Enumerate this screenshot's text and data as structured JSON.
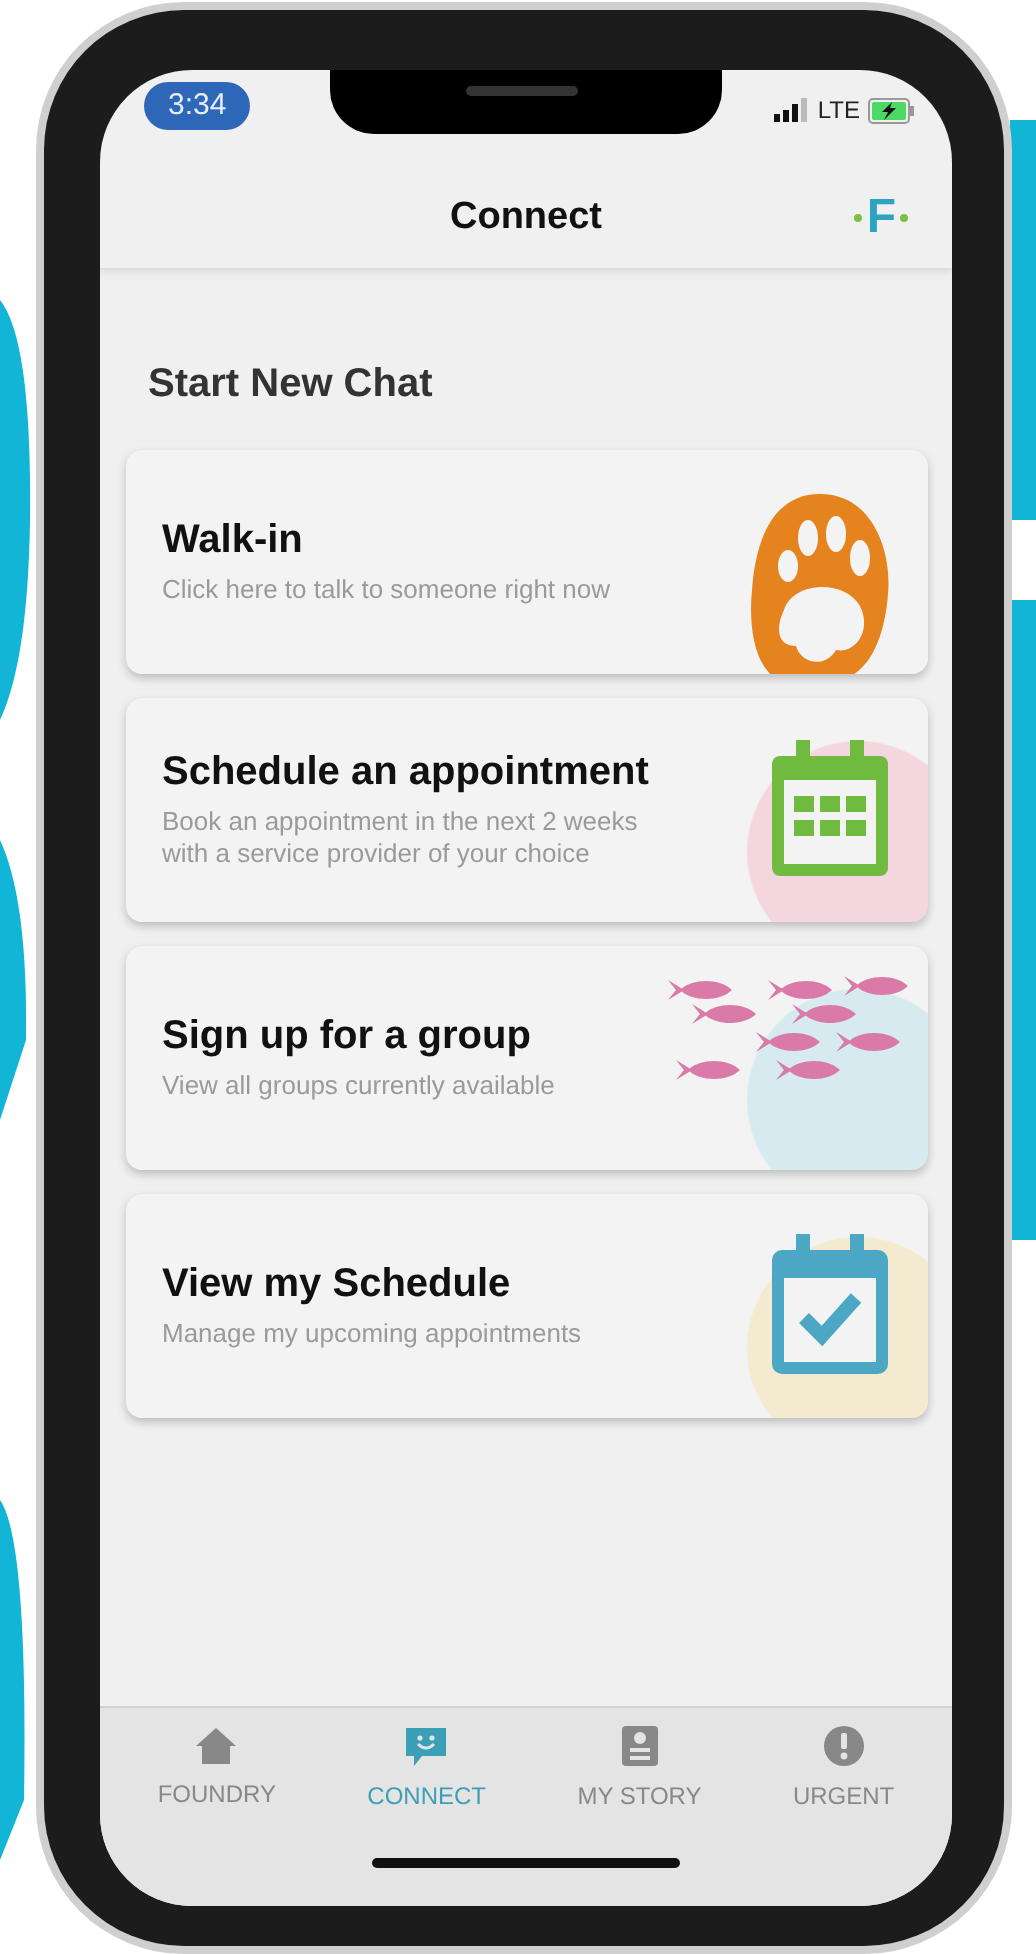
{
  "status_bar": {
    "time": "3:34",
    "network": "LTE",
    "charging": true
  },
  "header": {
    "title": "Connect",
    "logo": "F"
  },
  "section_title": "Start New Chat",
  "options": [
    {
      "kind": "paw",
      "title": "Walk-in",
      "subtitle": "Click here to talk to someone right now"
    },
    {
      "kind": "calendar",
      "title": "Schedule an appointment",
      "subtitle": "Book an appointment in the next 2 weeks with a service provider of your choice"
    },
    {
      "kind": "fish",
      "title": "Sign up for a group",
      "subtitle": "View all groups currently available"
    },
    {
      "kind": "check",
      "title": "View my Schedule",
      "subtitle": "Manage my upcoming appointments"
    }
  ],
  "tabs": [
    {
      "kind": "home",
      "label": "FOUNDRY",
      "selected": false
    },
    {
      "kind": "chat",
      "label": "CONNECT",
      "selected": true
    },
    {
      "kind": "story",
      "label": "MY STORY",
      "selected": false
    },
    {
      "kind": "alert",
      "label": "URGENT",
      "selected": false
    }
  ]
}
